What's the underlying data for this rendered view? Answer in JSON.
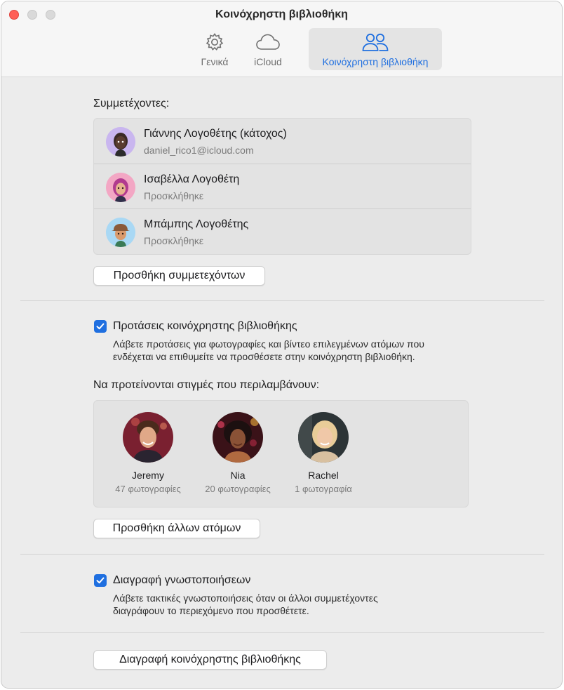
{
  "window": {
    "title": "Κοινόχρηστη βιβλιοθήκη"
  },
  "tabs": [
    {
      "label": "Γενικά",
      "icon": "gear-icon"
    },
    {
      "label": "iCloud",
      "icon": "cloud-icon"
    },
    {
      "label": "Κοινόχρηστη βιβλιοθήκη",
      "icon": "people-icon",
      "selected": true
    }
  ],
  "participants": {
    "title": "Συμμετέχοντες:",
    "items": [
      {
        "name": "Γιάννης Λογοθέτης (κάτοχος)",
        "sub": "daniel_rico1@icloud.com",
        "avatar_bg": "#c9b6ef"
      },
      {
        "name": "Ισαβέλλα Λογοθέτη",
        "sub": "Προσκλήθηκε",
        "avatar_bg": "#f3a7c4"
      },
      {
        "name": "Μπάμπης Λογοθέτης",
        "sub": "Προσκλήθηκε",
        "avatar_bg": "#a9d8f4"
      }
    ],
    "add_button": "Προσθήκη συμμετεχόντων"
  },
  "suggestions": {
    "checkbox_label": "Προτάσεις κοινόχρηστης βιβλιοθήκης",
    "checked": true,
    "description_line1": "Λάβετε προτάσεις για φωτογραφίες και βίντεο επιλεγμένων ατόμων που",
    "description_line2": "ενδέχεται να επιθυμείτε να προσθέσετε στην κοινόχρηστη βιβλιοθήκη.",
    "moments_title": "Να προτείνονται στιγμές που περιλαμβάνουν:",
    "people": [
      {
        "name": "Jeremy",
        "count": "47 φωτογραφίες"
      },
      {
        "name": "Nia",
        "count": "20 φωτογραφίες"
      },
      {
        "name": "Rachel",
        "count": "1 φωτογραφία"
      }
    ],
    "add_button": "Προσθήκη άλλων ατόμων"
  },
  "deletion": {
    "checkbox_label": "Διαγραφή γνωστοποιήσεων",
    "checked": true,
    "description_line1": "Λάβετε τακτικές γνωστοποιήσεις όταν οι άλλοι συμμετέχοντες",
    "description_line2": "διαγράφουν το περιεχόμενο που προσθέτετε."
  },
  "delete_library_button": "Διαγραφή κοινόχρηστης βιβλιοθήκης",
  "colors": {
    "accent": "#1f6fe0",
    "close": "#ff5f57"
  }
}
